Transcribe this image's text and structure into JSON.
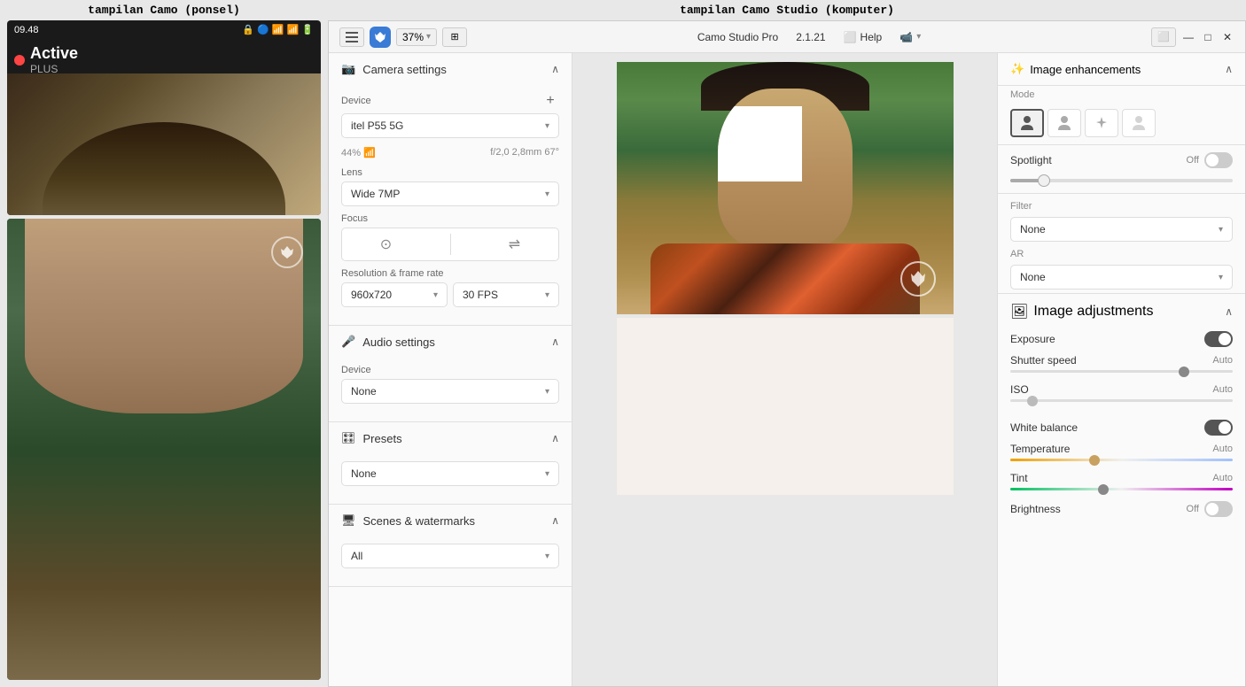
{
  "labels": {
    "phone": "tampilan Camo (ponsel)",
    "studio": "tampilan Camo Studio (komputer)"
  },
  "phone": {
    "time": "09.48",
    "status": "Active",
    "plus": "PLUS",
    "help_icon": "?",
    "settings_icon": "⚙",
    "wifi_icon": "📶"
  },
  "titlebar": {
    "zoom": "37%",
    "app_name": "Camo Studio Pro",
    "version": "2.1.21",
    "help": "Help"
  },
  "left_panel": {
    "camera_settings": "Camera settings",
    "device_label": "Device",
    "device_name": "itel P55 5G",
    "device_info_left": "44%  📶",
    "device_info_right": "f/2,0 2,8mm 67°",
    "lens_label": "Lens",
    "lens_value": "Wide 7MP",
    "focus_label": "Focus",
    "resolution_label": "Resolution & frame rate",
    "resolution_value": "960x720",
    "fps_value": "30 FPS",
    "audio_settings": "Audio settings",
    "audio_device_label": "Device",
    "audio_device_value": "None",
    "presets": "Presets",
    "presets_value": "None",
    "scenes_watermarks": "Scenes & watermarks",
    "scenes_value": "All"
  },
  "right_panel": {
    "image_enhancements": "Image enhancements",
    "mode_label": "Mode",
    "mode_icons": [
      "👤",
      "👤",
      "✨",
      "👤"
    ],
    "spotlight_label": "Spotlight",
    "spotlight_value": "Off",
    "filter_label": "Filter",
    "filter_value": "None",
    "ar_label": "AR",
    "ar_value": "None",
    "image_adjustments": "Image adjustments",
    "exposure_label": "Exposure",
    "shutter_speed_label": "Shutter speed",
    "shutter_speed_value": "Auto",
    "iso_label": "ISO",
    "iso_value": "Auto",
    "white_balance_label": "White balance",
    "white_balance_value": "On",
    "temperature_label": "Temperature",
    "temperature_value": "Auto",
    "tint_label": "Tint",
    "tint_value": "Auto",
    "brightness_label": "Brightness",
    "brightness_value": "Off"
  }
}
